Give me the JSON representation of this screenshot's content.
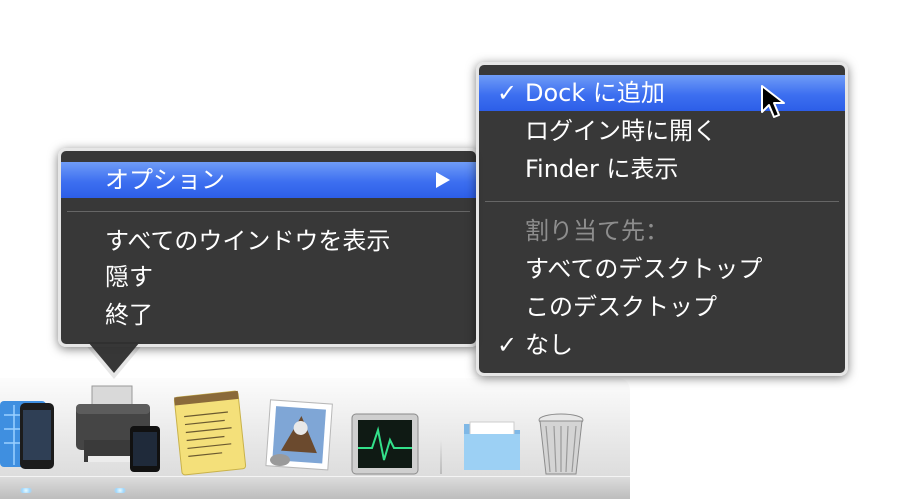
{
  "context_menu": {
    "options_label": "オプション",
    "show_all_windows_label": "すべてのウインドウを表示",
    "hide_label": "隠す",
    "quit_label": "終了"
  },
  "options_submenu": {
    "keep_in_dock_label": "Dock に追加",
    "open_at_login_label": "ログイン時に開く",
    "show_in_finder_label": "Finder に表示",
    "assign_to_header": "割り当て先：",
    "all_desktops_label": "すべてのデスクトップ",
    "this_desktop_label": "このデスクトップ",
    "none_label": "なし",
    "check_glyph": "✓"
  },
  "dock": {
    "items": [
      "xcode-icon",
      "printer-icon",
      "textedit-icon",
      "mail-icon",
      "activity-monitor-icon",
      "documents-folder-icon",
      "trash-icon"
    ]
  },
  "colors": {
    "menu_bg": "#303030",
    "highlight": "#3d6ff0",
    "menu_border": "#e6e6e6"
  }
}
